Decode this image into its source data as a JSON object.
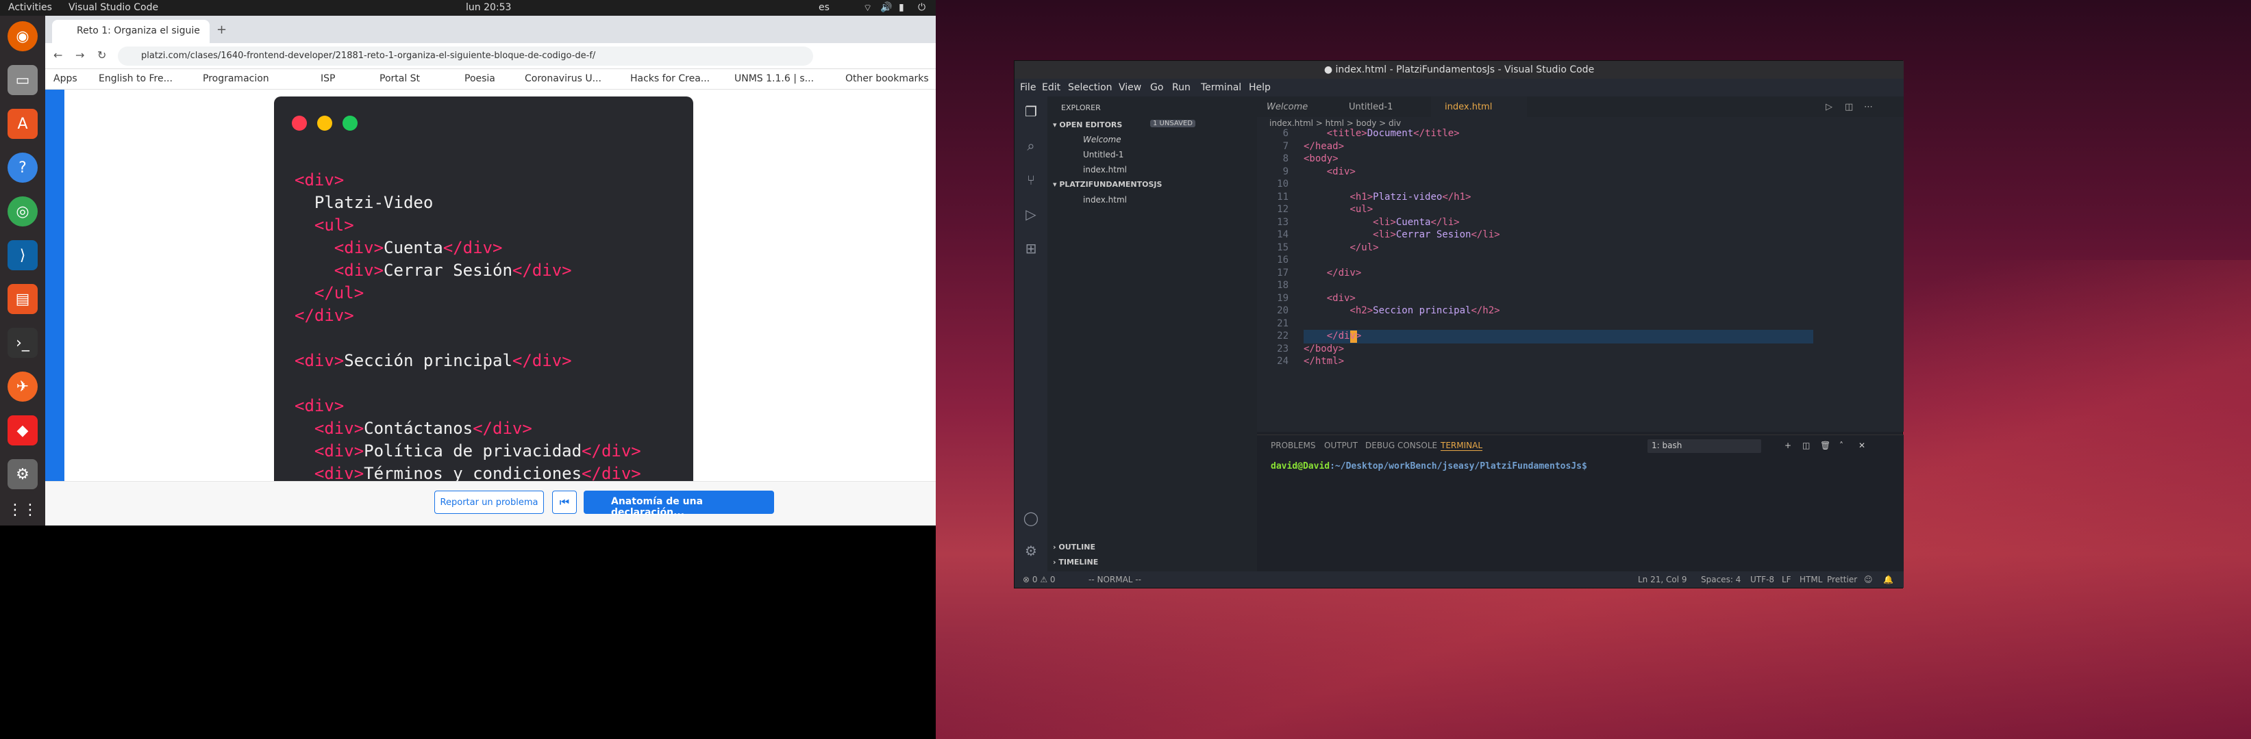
{
  "topbar": {
    "activities": "Activities",
    "app_menu": "Visual Studio Code",
    "clock": "lun 20:53",
    "lang": "es"
  },
  "chrome": {
    "tab_title": "Reto 1: Organiza el siguie",
    "url": "platzi.com/clases/1640-frontend-developer/21881-reto-1-organiza-el-siguiente-bloque-de-codigo-de-f/",
    "bookmarks": [
      "Apps",
      "English to Fre...",
      "Programacion",
      "ISP",
      "Portal St",
      "Poesia",
      "Coronavirus U...",
      "Hacks for Crea...",
      "UNMS 1.1.6 | s...",
      "Other bookmarks"
    ]
  },
  "code_card": {
    "lines": [
      {
        "t": "<div>",
        "kind": "tag"
      },
      {
        "t": "  Platzi-Video",
        "kind": "text"
      },
      {
        "t": "  <ul>",
        "kind": "tag"
      },
      {
        "t": "    <div>Cuenta</div>",
        "kind": "mixed"
      },
      {
        "t": "    <div>Cerrar Sesión</div>",
        "kind": "mixed"
      },
      {
        "t": "  </ul>",
        "kind": "tag"
      },
      {
        "t": "</div>",
        "kind": "tag"
      },
      {
        "t": "",
        "kind": "text"
      },
      {
        "t": "<div>Sección principal</div>",
        "kind": "mixed"
      },
      {
        "t": "",
        "kind": "text"
      },
      {
        "t": "<div>",
        "kind": "tag"
      },
      {
        "t": "  <div>Contáctanos</div>",
        "kind": "mixed"
      },
      {
        "t": "  <div>Política de privacidad</div>",
        "kind": "mixed"
      },
      {
        "t": "  <div>Términos y condiciones</div>",
        "kind": "mixed"
      }
    ]
  },
  "platzi_bottom": {
    "report": "Reportar un problema",
    "next": "Anatomía de una declaración..."
  },
  "vscode": {
    "title": "● index.html - PlatziFundamentosJs - Visual Studio Code",
    "menu": [
      "File",
      "Edit",
      "Selection",
      "View",
      "Go",
      "Run",
      "Terminal",
      "Help"
    ],
    "explorer_title": "EXPLORER",
    "open_editors": "OPEN EDITORS",
    "unsaved_badge": "1 UNSAVED",
    "open_files": [
      "Welcome",
      "Untitled-1",
      "index.html"
    ],
    "project": "PLATZIFUNDAMENTOSJS",
    "project_files": [
      "index.html"
    ],
    "outline": "OUTLINE",
    "timeline": "TIMELINE",
    "tabs": [
      "Welcome",
      "Untitled-1",
      "index.html"
    ],
    "breadcrumb": "index.html  >  html  >  body  >  div",
    "editor_lines": [
      {
        "n": "6",
        "t": "    <title>Document</title>"
      },
      {
        "n": "7",
        "t": "</head>"
      },
      {
        "n": "8",
        "t": "<body>"
      },
      {
        "n": "9",
        "t": "    <div>"
      },
      {
        "n": "10",
        "t": ""
      },
      {
        "n": "11",
        "t": "        <h1>Platzi-video</h1>"
      },
      {
        "n": "12",
        "t": "        <ul>"
      },
      {
        "n": "13",
        "t": "            <li>Cuenta</li>"
      },
      {
        "n": "14",
        "t": "            <li>Cerrar Sesion</li>"
      },
      {
        "n": "15",
        "t": "        </ul>"
      },
      {
        "n": "16",
        "t": ""
      },
      {
        "n": "17",
        "t": "    </div>"
      },
      {
        "n": "18",
        "t": ""
      },
      {
        "n": "19",
        "t": "    <div>"
      },
      {
        "n": "20",
        "t": "        <h2>Seccion principal</h2>"
      },
      {
        "n": "21",
        "t": ""
      },
      {
        "n": "22",
        "t": "    </div>"
      },
      {
        "n": "23",
        "t": "</body>"
      },
      {
        "n": "24",
        "t": "</html>"
      }
    ],
    "panel_tabs": [
      "PROBLEMS",
      "OUTPUT",
      "DEBUG CONSOLE",
      "TERMINAL"
    ],
    "terminal_select": "1: bash",
    "prompt_user": "david@David",
    "prompt_path": ":~/Desktop/workBench/jseasy/PlatziFundamentosJs$",
    "status_left": [
      "⊗ 0  ⚠ 0",
      "-- NORMAL --"
    ],
    "status_right": [
      "Ln 21, Col 9",
      "Spaces: 4",
      "UTF-8",
      "LF",
      "HTML",
      "Prettier"
    ]
  },
  "colors": {
    "platzi_blue": "#1a75e8",
    "tag_pink": "#ff2a6d",
    "vs_bg": "#23272e"
  }
}
